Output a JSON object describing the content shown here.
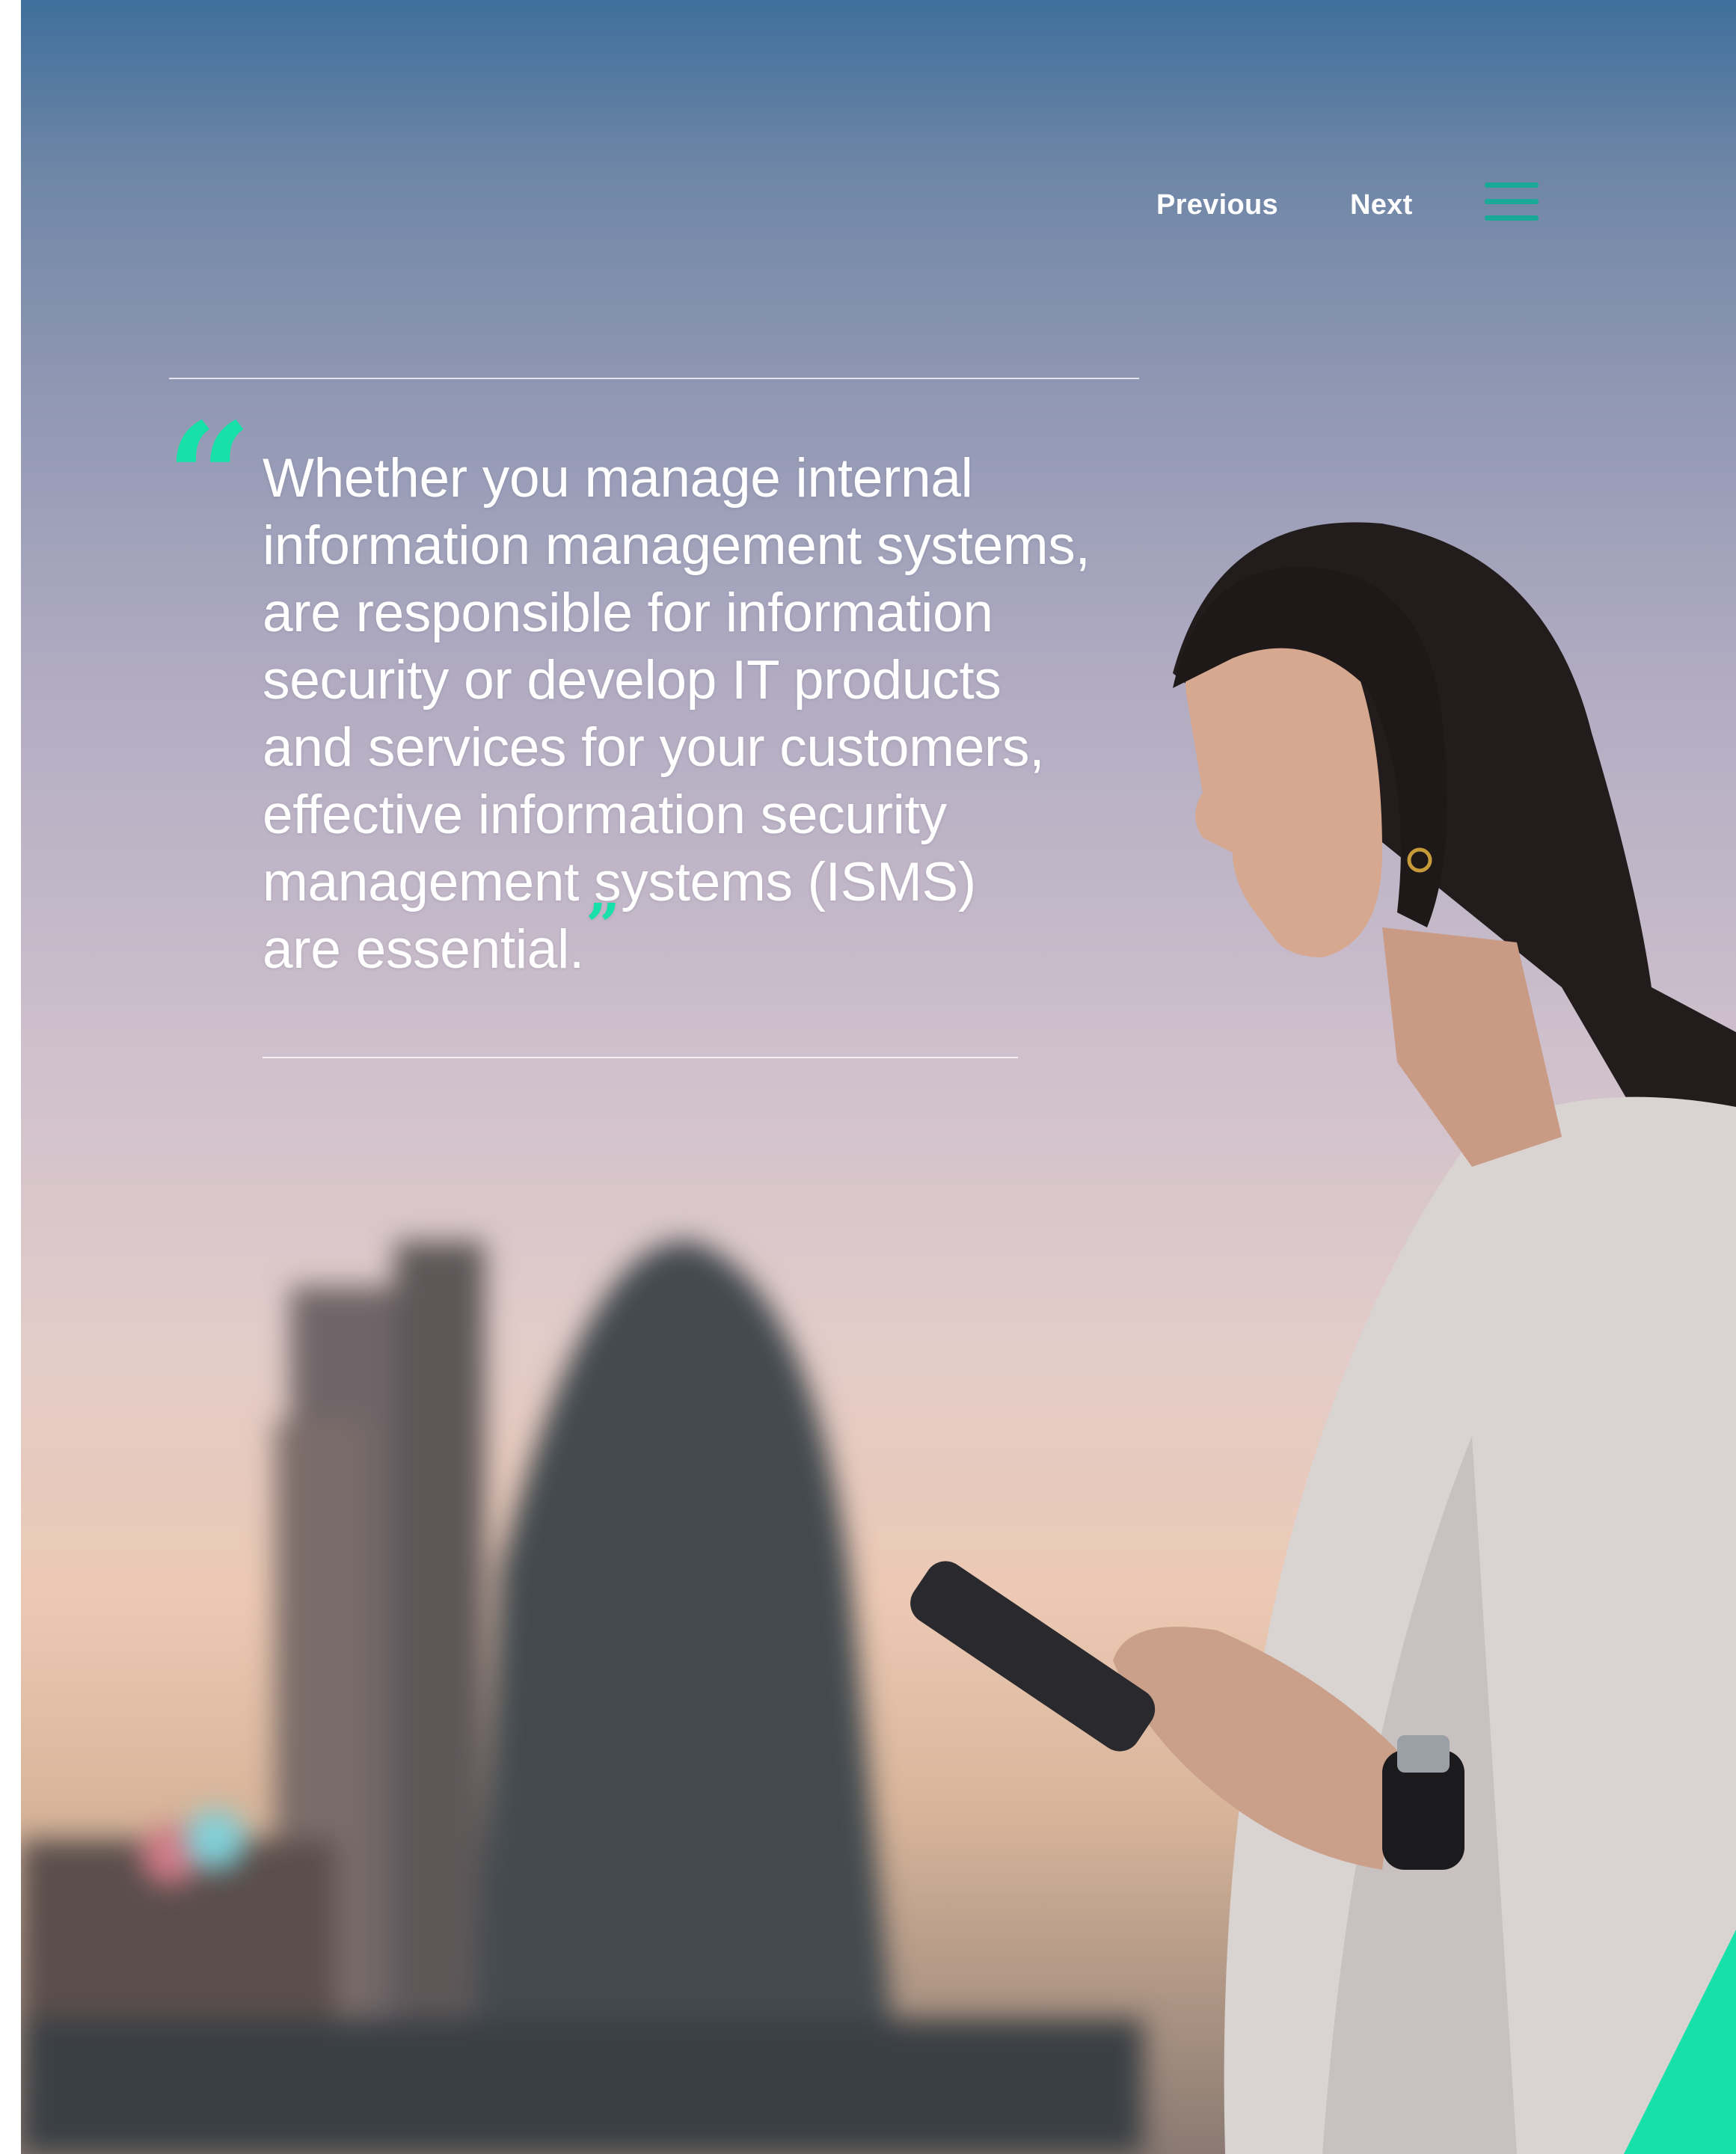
{
  "nav": {
    "previous_label": "Previous",
    "next_label": "Next",
    "menu_icon": "hamburger-menu-icon"
  },
  "quote": {
    "lines": [
      "Whether you manage internal",
      "information management systems,",
      "are responsible for information",
      "security or develop IT products",
      "and services for your customers,",
      "effective information security",
      "management systems (ISMS)",
      "are essential."
    ],
    "open_mark": "“",
    "close_mark": "”"
  },
  "colors": {
    "accent": "#17e0a8",
    "menu": "#1aa897",
    "text": "#ffffff"
  },
  "background_image": "woman-looking-at-phone-city-dusk"
}
